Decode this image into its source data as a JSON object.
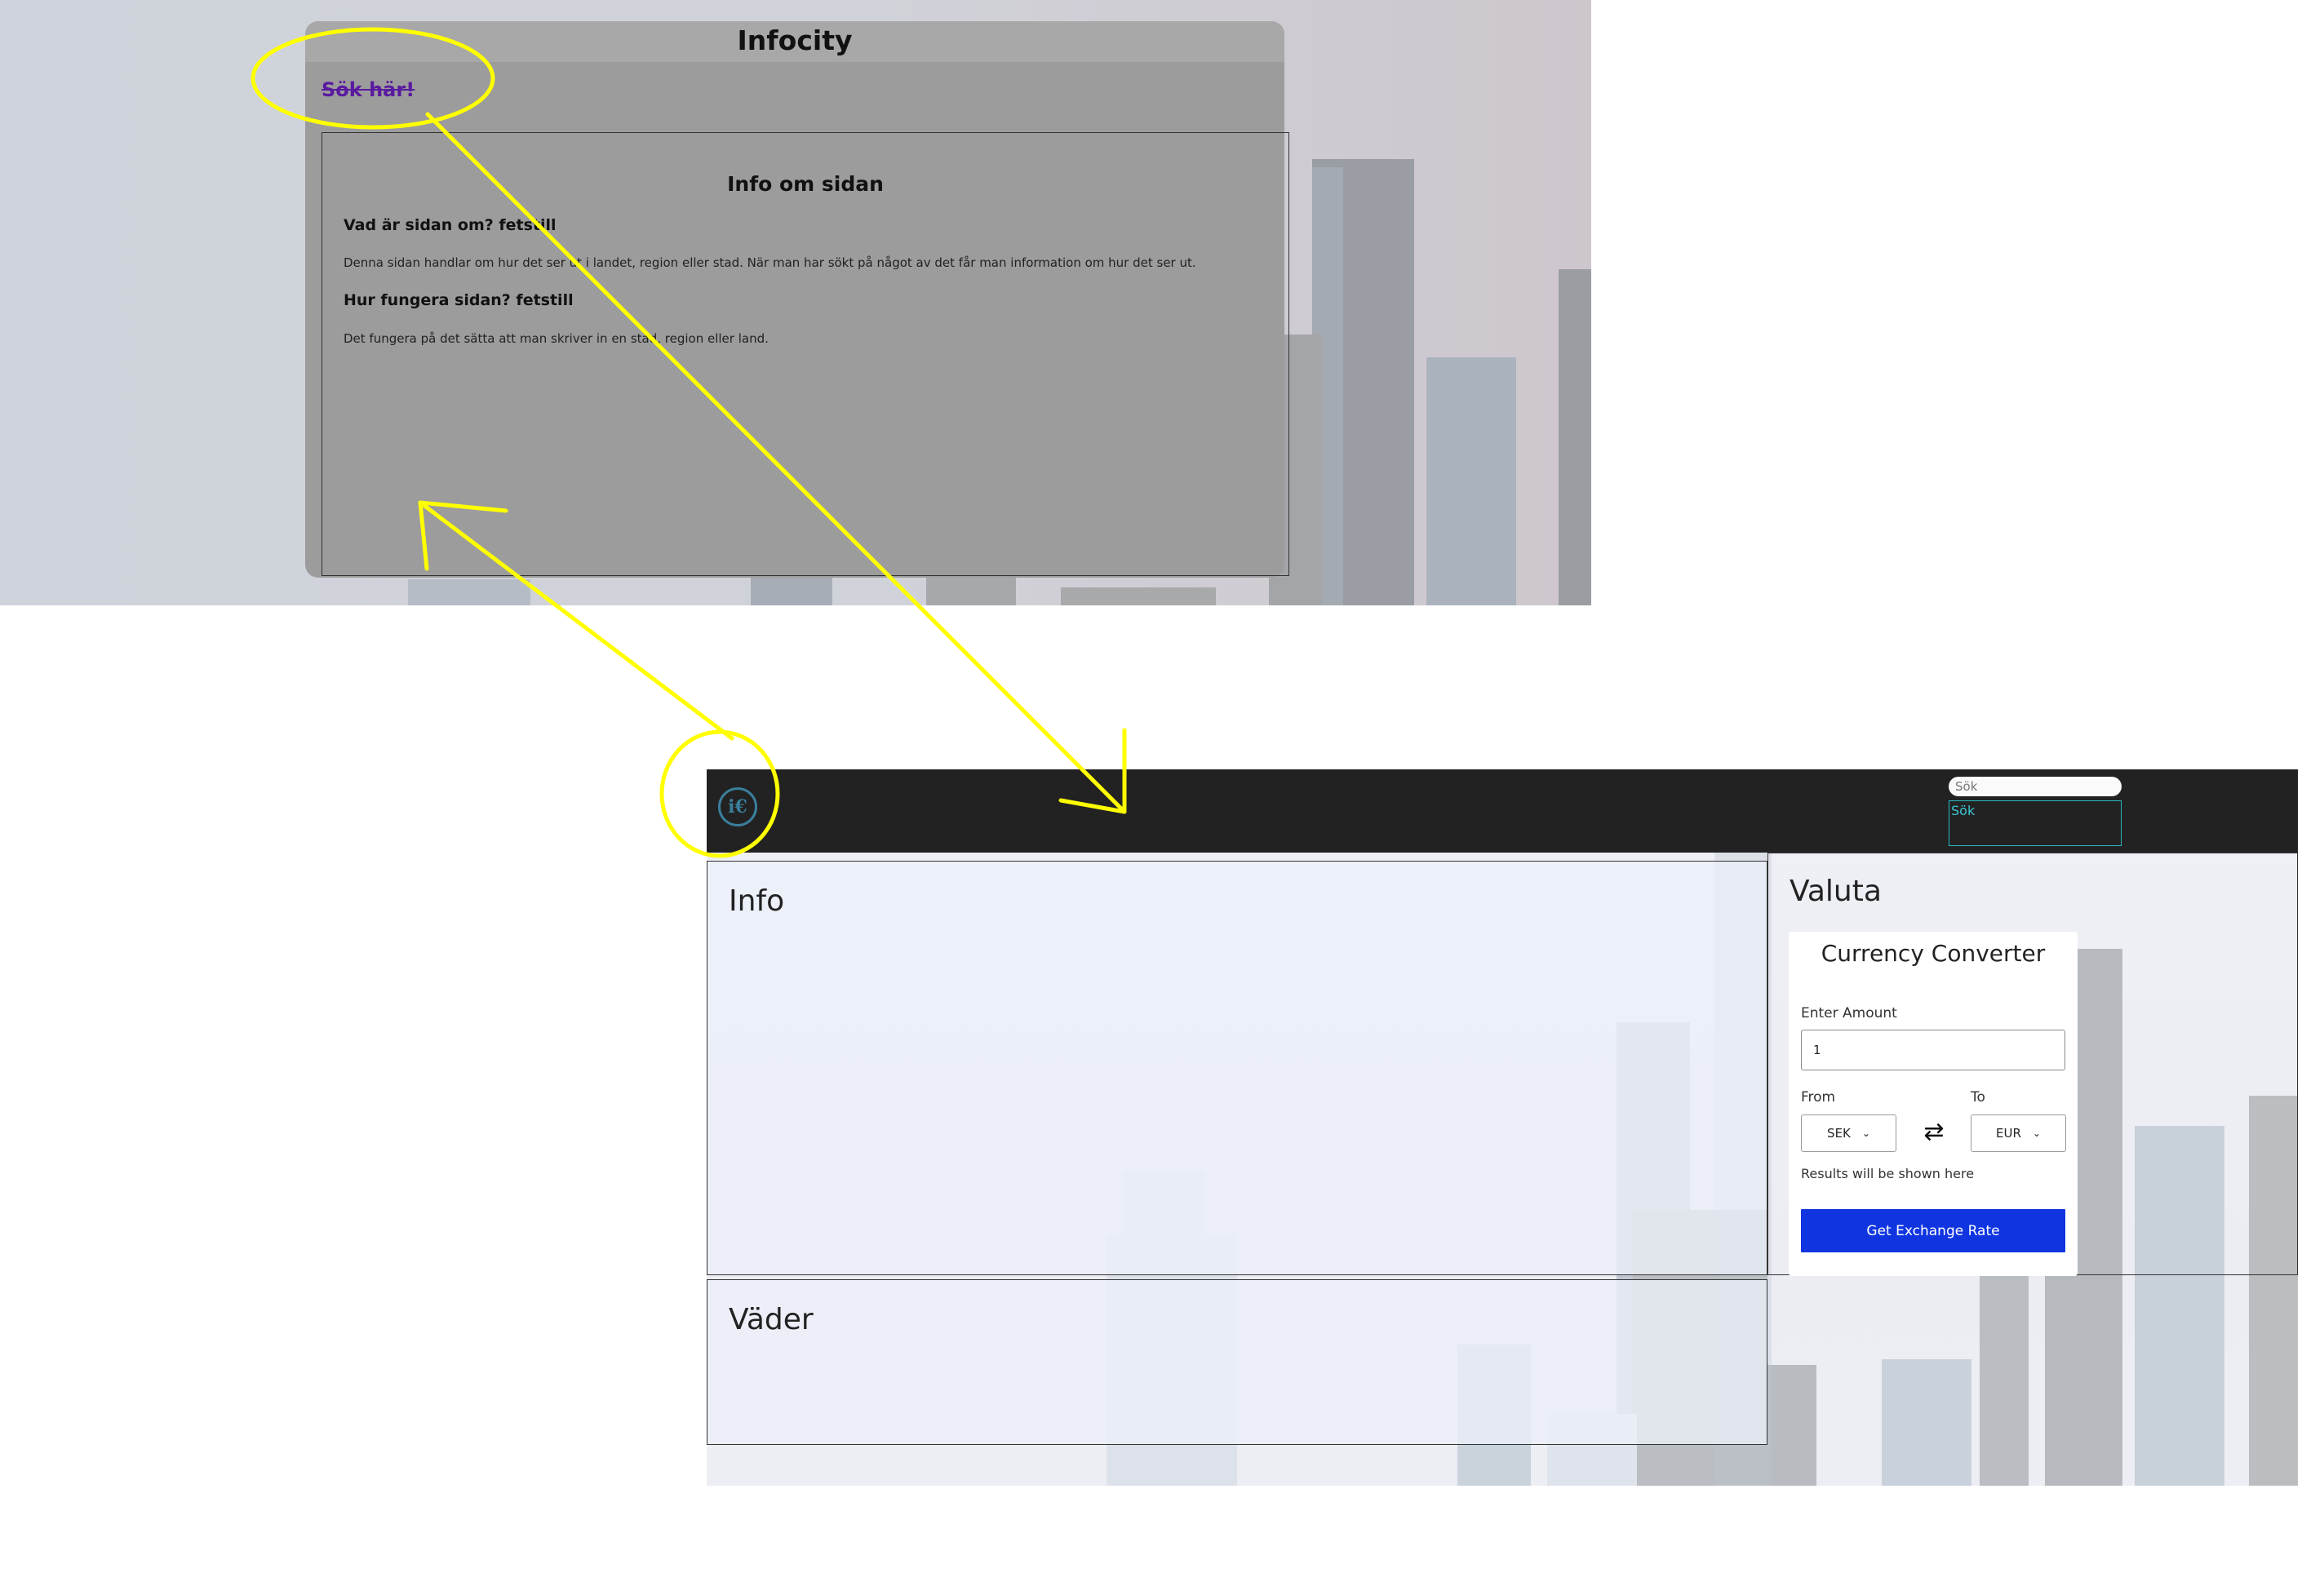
{
  "old_page": {
    "title": "Infocity",
    "search_link": "Sök här!",
    "info_box": {
      "heading": "Info om sidan",
      "q1": "Vad är sidan om? fetstill",
      "p1": "Denna sidan handlar om hur det ser ut i landet, region eller stad. När man har sökt på något av det får man information om hur det ser ut.",
      "q2": "Hur fungera sidan? fetstill",
      "p2": "Det fungera på det sätta att man skriver in en stad, region eller land."
    }
  },
  "new_page": {
    "navbar": {
      "logo_text": "i€",
      "search_placeholder": "Sök",
      "search_button": "Sök"
    },
    "info_panel": {
      "title": "Info"
    },
    "weather_panel": {
      "title": "Väder"
    },
    "valuta_panel": {
      "title": "Valuta",
      "converter": {
        "title": "Currency Converter",
        "amount_label": "Enter Amount",
        "amount_value": "1",
        "from_label": "From",
        "to_label": "To",
        "from_value": "SEK",
        "to_value": "EUR",
        "result_text": "Results will be shown here",
        "button_label": "Get Exchange Rate"
      }
    }
  },
  "colors": {
    "annotation": "#ffff00",
    "navbar": "#222222",
    "accent_button": "#1035e0",
    "search_outline": "#2ab7c2",
    "old_card": "#9c9c9c"
  },
  "icons": {
    "logo": "info-euro-logo-icon",
    "swap": "swap-arrows-icon",
    "chevron": "chevron-down-icon"
  }
}
